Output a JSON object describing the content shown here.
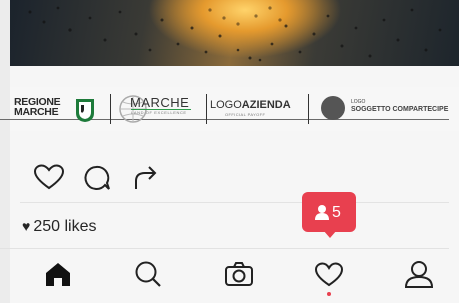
{
  "logos": {
    "regione_line1": "REGIONE",
    "regione_line2": "MARCHE",
    "marche": "MARCHE",
    "marche_sub": "LAND OF EXCELLENCE",
    "azienda_prefix": "LOGO",
    "azienda_bold": "AZIENDA",
    "payoff": "OFFICIAL PAYOFF",
    "logo_small": "LOGO",
    "soggetto": "SOGGETTO COMPARTECIPE"
  },
  "post": {
    "likes_text": "250 likes"
  },
  "notification": {
    "count": "5"
  },
  "nav": {
    "items": [
      "home-icon",
      "search-icon",
      "camera-icon",
      "heart-icon",
      "profile-icon"
    ]
  },
  "colors": {
    "accent": "#e8404f",
    "text": "#262626",
    "background": "#f6f6f6"
  }
}
